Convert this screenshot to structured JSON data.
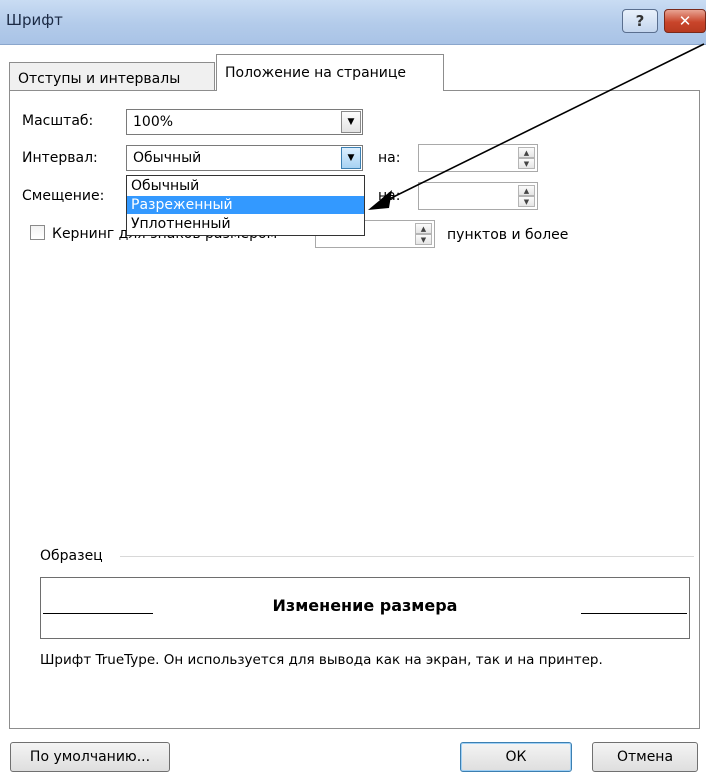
{
  "window": {
    "title": "Шрифт",
    "help_button": "?",
    "close_button": "✕"
  },
  "tabs": [
    {
      "label": "Отступы и интервалы"
    },
    {
      "label": "Положение на странице"
    }
  ],
  "scale": {
    "label": "Масштаб:",
    "value": "100%"
  },
  "spacing": {
    "label": "Интервал:",
    "value": "Обычный",
    "by_label": "на:",
    "by_value": ""
  },
  "offset": {
    "label": "Смещение:",
    "by_label": "на:",
    "by_value": ""
  },
  "dropdown_options": [
    "Обычный",
    "Разреженный",
    "Уплотненный"
  ],
  "selected_option": "Разреженный",
  "kerning": {
    "label": "Кернинг для знаков размером",
    "value": "",
    "suffix": "пунктов и более",
    "checked": false
  },
  "sample": {
    "group_label": "Образец",
    "text": "Изменение размера",
    "note": "Шрифт TrueType. Он используется для вывода как на экран, так и на принтер."
  },
  "buttons": {
    "default": "По умолчанию...",
    "ok": "ОК",
    "cancel": "Отмена"
  },
  "icons": {
    "combo_arrow": "▼",
    "spin_up": "▲",
    "spin_down": "▼"
  }
}
